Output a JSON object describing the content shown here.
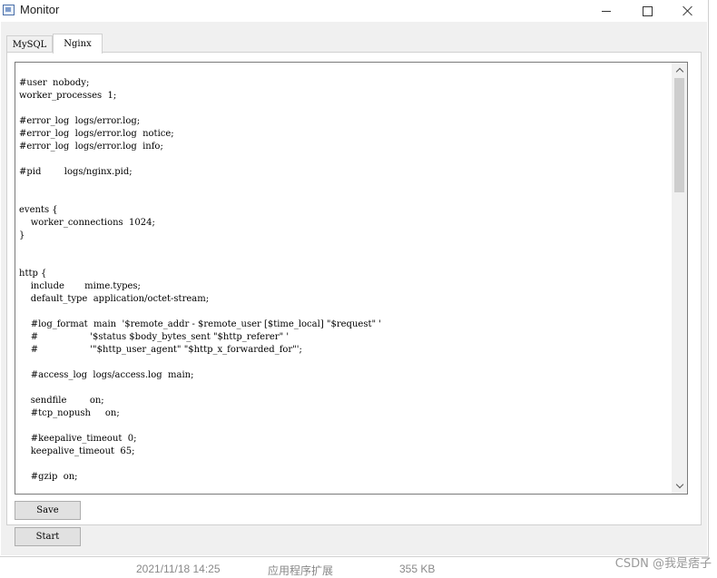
{
  "window": {
    "title": "Monitor"
  },
  "tabs": [
    {
      "label": "MySQL",
      "active": false
    },
    {
      "label": "Nginx",
      "active": true
    }
  ],
  "editor": {
    "lines": [
      "",
      "#user  nobody;",
      "worker_processes  1;",
      "",
      "#error_log  logs/error.log;",
      "#error_log  logs/error.log  notice;",
      "#error_log  logs/error.log  info;",
      "",
      "#pid        logs/nginx.pid;",
      "",
      "",
      "events {",
      "    worker_connections  1024;",
      "}",
      "",
      "",
      "http {",
      "    include       mime.types;",
      "    default_type  application/octet-stream;",
      "",
      "    #log_format  main  '$remote_addr - $remote_user [$time_local] \"$request\" '",
      "    #                  '$status $body_bytes_sent \"$http_referer\" '",
      "    #                  '\"$http_user_agent\" \"$http_x_forwarded_for\"';",
      "",
      "    #access_log  logs/access.log  main;",
      "",
      "    sendfile        on;",
      "    #tcp_nopush     on;",
      "",
      "    #keepalive_timeout  0;",
      "    keepalive_timeout  65;",
      "",
      "    #gzip  on;"
    ],
    "scroll_position": 0
  },
  "buttons": {
    "save_label": "Save",
    "start_label": "Start"
  },
  "background": {
    "date_text": "2021/11/18 14:25",
    "type_text": "应用程序扩展",
    "size_text": "355 KB"
  },
  "watermark": "CSDN @我是痞子",
  "colors": {
    "client_bg": "#f0f0f0",
    "button_bg": "#e1e1e1",
    "scroll_thumb": "#cdcdcd"
  }
}
